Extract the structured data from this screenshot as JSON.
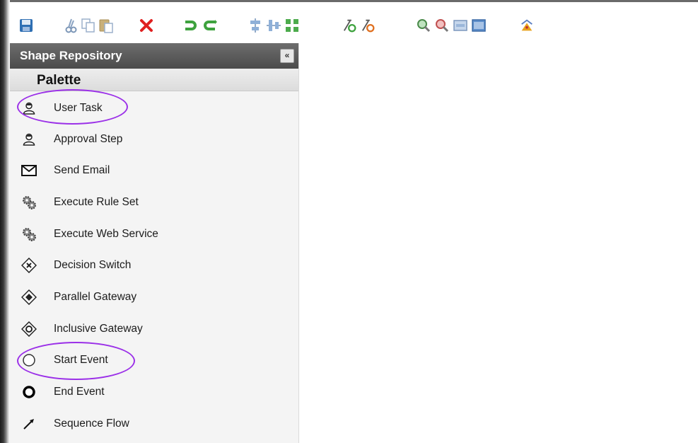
{
  "sidebar": {
    "header_title": "Shape Repository",
    "collapse_glyph": "«",
    "palette_title": "Palette",
    "items": [
      {
        "label": "User Task",
        "icon": "user-icon",
        "highlighted": true
      },
      {
        "label": "Approval Step",
        "icon": "user-icon",
        "highlighted": false
      },
      {
        "label": "Send Email",
        "icon": "envelope-icon",
        "highlighted": false
      },
      {
        "label": "Execute Rule Set",
        "icon": "gears-icon",
        "highlighted": false
      },
      {
        "label": "Execute Web Service",
        "icon": "gears-icon",
        "highlighted": false
      },
      {
        "label": "Decision Switch",
        "icon": "exclusive-gateway-icon",
        "highlighted": false
      },
      {
        "label": "Parallel Gateway",
        "icon": "parallel-gateway-icon",
        "highlighted": false
      },
      {
        "label": "Inclusive Gateway",
        "icon": "inclusive-gateway-icon",
        "highlighted": false
      },
      {
        "label": "Start Event",
        "icon": "start-event-icon",
        "highlighted": true
      },
      {
        "label": "End Event",
        "icon": "end-event-icon",
        "highlighted": false
      },
      {
        "label": "Sequence Flow",
        "icon": "arrow-icon",
        "highlighted": false
      }
    ]
  },
  "toolbar": {
    "buttons": [
      "save-icon",
      "cut-icon",
      "copy-icon",
      "paste-icon",
      "delete-icon",
      "undo-icon",
      "redo-icon",
      "align-vertical-icon",
      "align-horizontal-icon",
      "group-icon",
      "add-docker-icon",
      "remove-docker-icon",
      "zoom-in-icon",
      "zoom-out-icon",
      "zoom-standard-icon",
      "zoom-fit-icon",
      "auto-layout-icon"
    ]
  },
  "colors": {
    "highlight": "#9b30e8",
    "sidebar_header": "#555555",
    "save_blue": "#2f6fb3",
    "delete_red": "#e02020",
    "undo_green": "#3ea23e"
  }
}
